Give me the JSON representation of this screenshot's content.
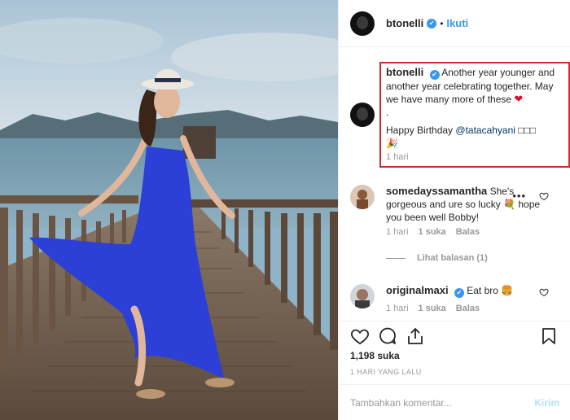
{
  "header": {
    "username": "btonelli",
    "verified_mark": "✔",
    "separator": "•",
    "follow_label": "Ikuti"
  },
  "caption": {
    "username": "btonelli",
    "line1": "Another year younger and another year celebrating together. May we have many more of these",
    "heart": "❤",
    "period": ".",
    "birthday_prefix": "Happy Birthday ",
    "mention": "@tatacahyani",
    "boxes": "□□□",
    "party": "🎉",
    "time": "1 hari"
  },
  "comments": [
    {
      "username": "somedayssamantha",
      "text_before": " She's gorgeous and ure so lucky ",
      "emoji": "💐",
      "text_after": " hope you been well Bobby!",
      "time": "1 hari",
      "likes": "1 suka",
      "reply": "Balas",
      "more": "•••"
    },
    {
      "username": "originalmaxi",
      "text": " Eat bro ",
      "emoji": "🍔",
      "time": "1 hari",
      "likes": "1 suka",
      "reply": "Balas"
    }
  ],
  "view_replies": "Lihat balasan (1)",
  "actions": {
    "icons": [
      "heart-outline-icon",
      "comment-icon",
      "share-icon",
      "bookmark-icon"
    ]
  },
  "likes_count": "1,198 suka",
  "date": "1 HARI YANG LALU",
  "add_comment": {
    "placeholder": "Tambahkan komentar...",
    "post_label": "Kirim"
  },
  "colors": {
    "link": "#3897f0",
    "highlight_border": "#d12b2b",
    "muted": "#999999",
    "post_disabled": "#b2dffc"
  }
}
